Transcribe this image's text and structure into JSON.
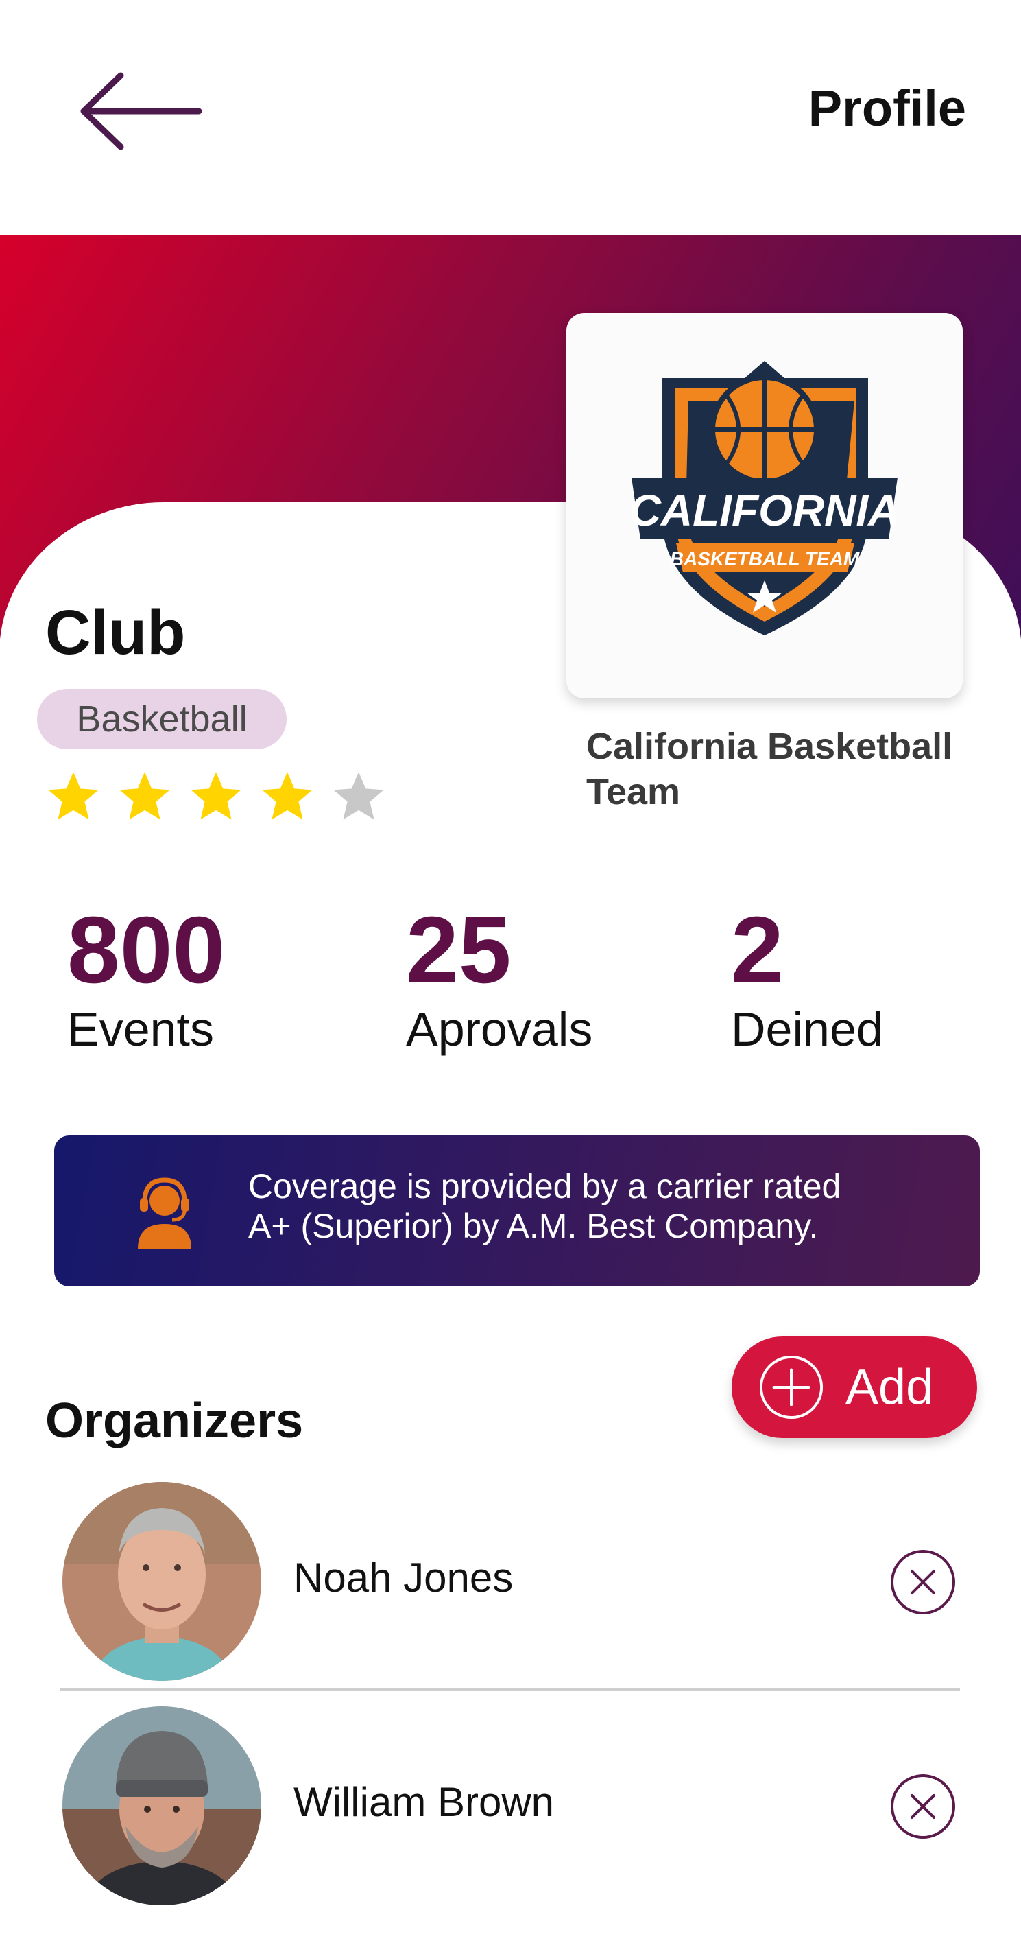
{
  "header": {
    "title": "Profile",
    "back_icon": "arrow-left-icon"
  },
  "club": {
    "heading": "Club",
    "sport": "Basketball",
    "rating": 4,
    "rating_max": 5,
    "team_name": "California Basketball Team",
    "logo": {
      "main_text": "CALIFORNIA",
      "banner_text": "BASKETBALL TEAM"
    }
  },
  "stats": [
    {
      "value": "800",
      "label": "Events"
    },
    {
      "value": "25",
      "label": "Aprovals"
    },
    {
      "value": "2",
      "label": "Deined"
    }
  ],
  "notice": {
    "icon": "support-agent-icon",
    "text_line1": "Coverage is provided by a carrier rated",
    "text_line2": "A+ (Superior) by A.M. Best Company."
  },
  "organizers": {
    "heading": "Organizers",
    "add_label": "Add",
    "items": [
      {
        "name": "Noah Jones"
      },
      {
        "name": "William Brown"
      }
    ]
  },
  "colors": {
    "accent": "#5e1046",
    "add_button": "#d4163e",
    "star_filled": "#ffd400",
    "star_empty": "#c8c8c8"
  }
}
